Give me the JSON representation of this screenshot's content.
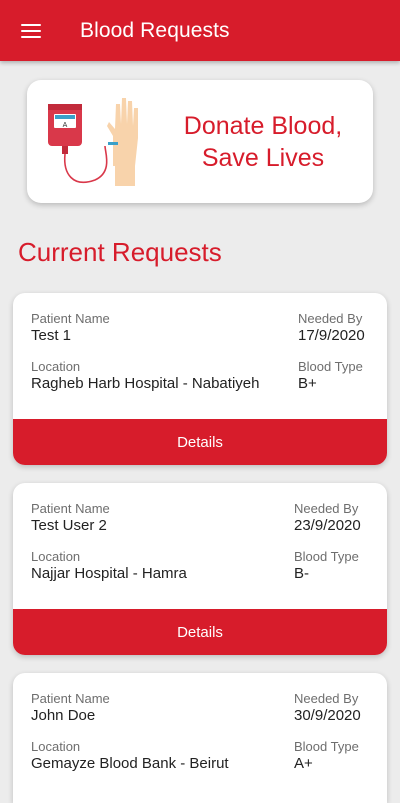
{
  "appbar": {
    "title": "Blood Requests",
    "menu_icon": "hamburger-menu-icon"
  },
  "banner": {
    "text": "Donate Blood, Save Lives",
    "illustration": "blood-donation-icon",
    "bag_label": "A"
  },
  "section_title": "Current Requests",
  "labels": {
    "patient_name": "Patient Name",
    "needed_by": "Needed By",
    "location": "Location",
    "blood_type": "Blood Type",
    "details": "Details"
  },
  "requests": [
    {
      "patient_name": "Test 1",
      "needed_by": "17/9/2020",
      "location": "Ragheb Harb Hospital - Nabatiyeh",
      "blood_type": "B+"
    },
    {
      "patient_name": "Test User 2",
      "needed_by": "23/9/2020",
      "location": "Najjar Hospital - Hamra",
      "blood_type": "B-"
    },
    {
      "patient_name": "John Doe",
      "needed_by": "30/9/2020",
      "location": "Gemayze Blood Bank - Beirut",
      "blood_type": "A+"
    }
  ],
  "colors": {
    "primary": "#d71c2b",
    "background": "#ececec"
  }
}
